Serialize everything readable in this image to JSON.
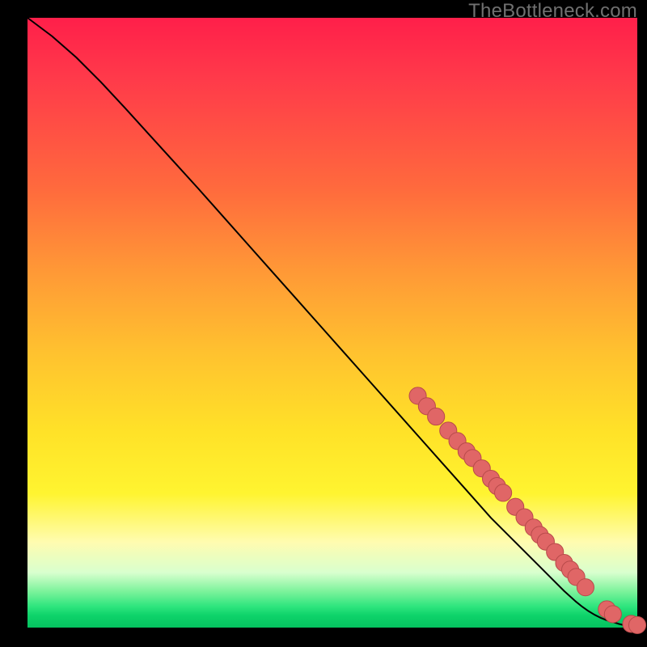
{
  "watermark": "TheBottleneck.com",
  "chart_data": {
    "type": "line",
    "title": "",
    "xlabel": "",
    "ylabel": "",
    "xlim": [
      0,
      100
    ],
    "ylim": [
      0,
      100
    ],
    "series": [
      {
        "name": "curve",
        "x": [
          0,
          4,
          8,
          12,
          16,
          20,
          24,
          28,
          32,
          36,
          40,
          44,
          48,
          52,
          56,
          60,
          64,
          68,
          72,
          76,
          80,
          84,
          86,
          88,
          90,
          91,
          92,
          93,
          94,
          95,
          96,
          97,
          98,
          100
        ],
        "values": [
          100,
          97,
          93.5,
          89.5,
          85.2,
          80.8,
          76.4,
          72,
          67.5,
          63,
          58.5,
          54,
          49.5,
          45,
          40.5,
          36,
          31.5,
          27,
          22.5,
          18,
          14,
          10,
          8,
          6,
          4.2,
          3.4,
          2.7,
          2.1,
          1.6,
          1.2,
          0.9,
          0.6,
          0.35,
          0.15
        ]
      }
    ],
    "markers": [
      {
        "x": 64,
        "y": 38.0
      },
      {
        "x": 65.5,
        "y": 36.3
      },
      {
        "x": 67,
        "y": 34.6
      },
      {
        "x": 69,
        "y": 32.3
      },
      {
        "x": 70.5,
        "y": 30.6
      },
      {
        "x": 72,
        "y": 28.9
      },
      {
        "x": 73,
        "y": 27.8
      },
      {
        "x": 74.5,
        "y": 26.1
      },
      {
        "x": 76,
        "y": 24.4
      },
      {
        "x": 77,
        "y": 23.2
      },
      {
        "x": 78,
        "y": 22.1
      },
      {
        "x": 80,
        "y": 19.8
      },
      {
        "x": 81.5,
        "y": 18.1
      },
      {
        "x": 83,
        "y": 16.4
      },
      {
        "x": 84,
        "y": 15.2
      },
      {
        "x": 85,
        "y": 14.1
      },
      {
        "x": 86.5,
        "y": 12.4
      },
      {
        "x": 88,
        "y": 10.6
      },
      {
        "x": 89,
        "y": 9.5
      },
      {
        "x": 90,
        "y": 8.3
      },
      {
        "x": 91.5,
        "y": 6.6
      },
      {
        "x": 95,
        "y": 3.0
      },
      {
        "x": 96,
        "y": 2.2
      },
      {
        "x": 99,
        "y": 0.6
      },
      {
        "x": 100,
        "y": 0.4
      }
    ],
    "marker_color": "#e06666",
    "marker_edge": "#b84a4a",
    "marker_radius_pct": 1.4
  }
}
